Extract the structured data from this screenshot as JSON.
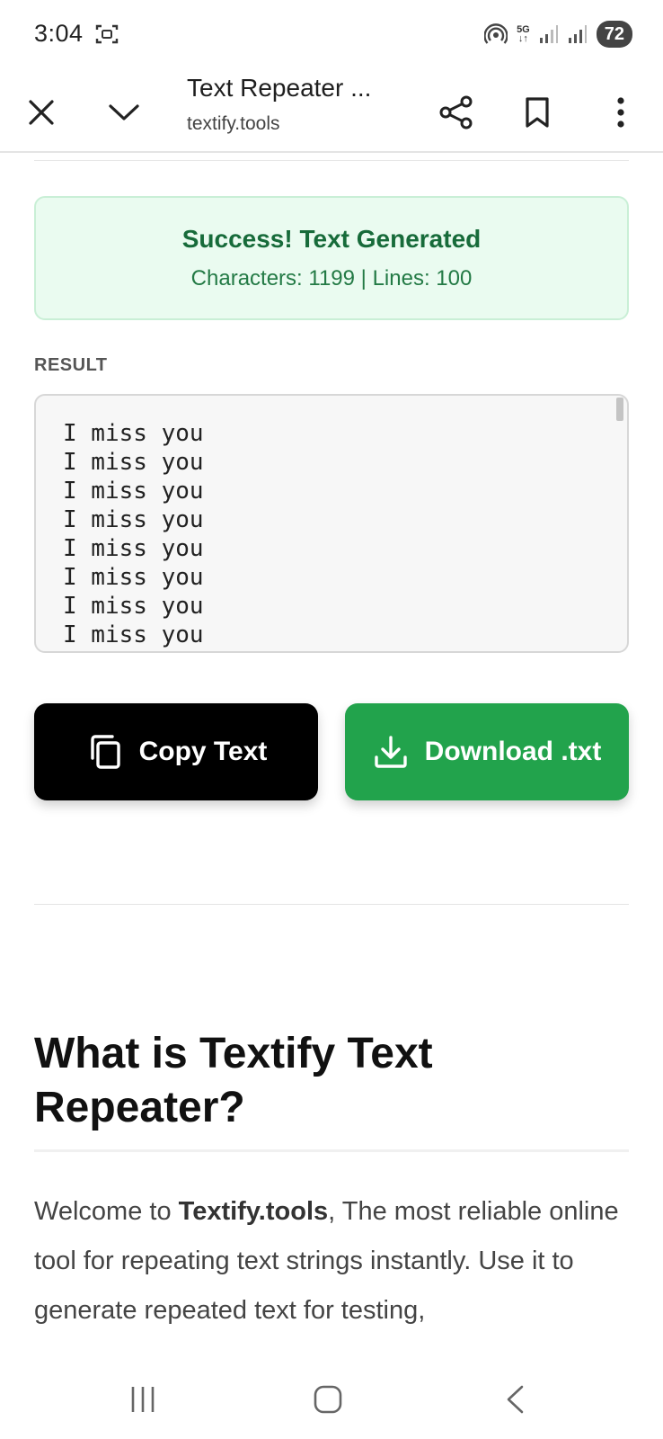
{
  "status": {
    "time": "3:04",
    "network": "5G",
    "battery": "72"
  },
  "browser": {
    "title": "Text Repeater ...",
    "url": "textify.tools"
  },
  "success": {
    "title": "Success! Text Generated",
    "stats": "Characters: 1199 | Lines: 100"
  },
  "result": {
    "label": "RESULT",
    "text": "I miss you\nI miss you\nI miss you\nI miss you\nI miss you\nI miss you\nI miss you\nI miss you"
  },
  "buttons": {
    "copy_label": "Copy Text",
    "download_label": "Download .txt"
  },
  "section": {
    "heading": "What is Textify Text Repeater?",
    "paragraph_pre": "Welcome to ",
    "paragraph_bold": "Textify.tools",
    "paragraph_post": ", The most reliable online tool for repeating text strings instantly. Use it to generate repeated text for testing,"
  },
  "colors": {
    "success_bg": "#eafbf0",
    "success_text": "#176b3a",
    "download_green": "#22a34c",
    "copy_black": "#000000"
  },
  "icons": {
    "close": "close-icon",
    "minimize": "chevron-down-icon",
    "share": "share-icon",
    "bookmark": "bookmark-icon",
    "more": "more-vert-icon",
    "copy": "copy-icon",
    "download": "download-icon"
  }
}
